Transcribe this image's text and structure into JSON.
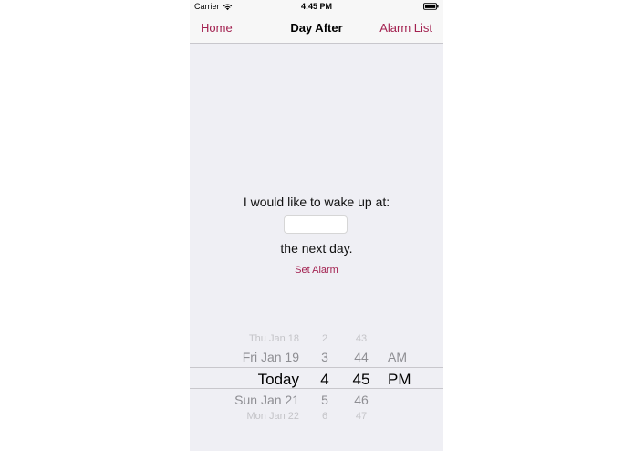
{
  "status_bar": {
    "carrier": "Carrier",
    "time": "4:45 PM"
  },
  "nav": {
    "left": "Home",
    "title": "Day After",
    "right": "Alarm List"
  },
  "content": {
    "prompt": "I would like to wake up at:",
    "time_value": "",
    "suffix": "the next day.",
    "set_alarm": "Set Alarm"
  },
  "picker": {
    "rows": [
      {
        "date": "Thu Jan 18",
        "hour": "2",
        "minute": "43",
        "ampm": ""
      },
      {
        "date": "Fri Jan 19",
        "hour": "3",
        "minute": "44",
        "ampm": "AM"
      },
      {
        "date": "Today",
        "hour": "4",
        "minute": "45",
        "ampm": "PM"
      },
      {
        "date": "Sun Jan 21",
        "hour": "5",
        "minute": "46",
        "ampm": ""
      },
      {
        "date": "Mon Jan 22",
        "hour": "6",
        "minute": "47",
        "ampm": ""
      }
    ]
  },
  "colors": {
    "accent": "#a32150",
    "background": "#efeff4"
  }
}
